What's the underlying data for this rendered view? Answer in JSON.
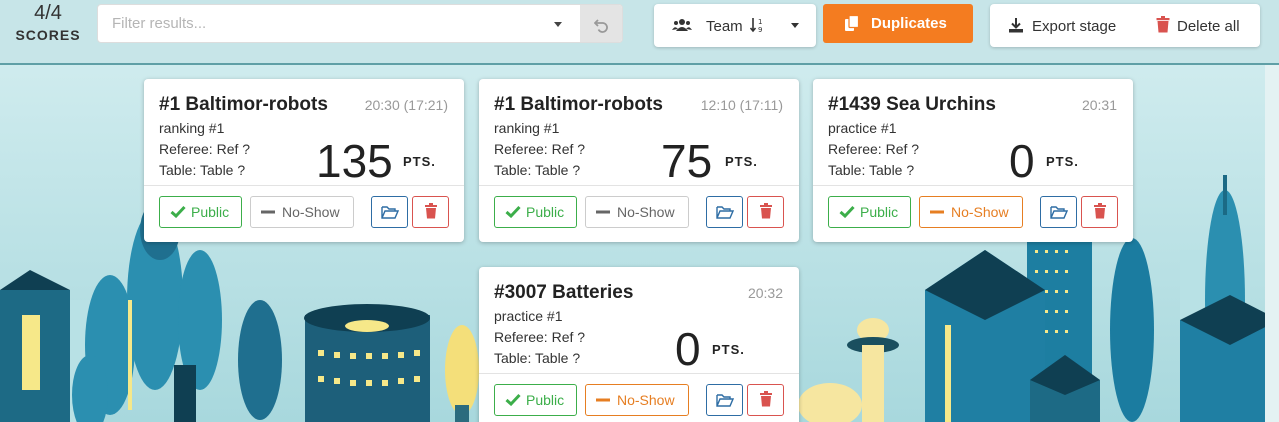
{
  "header": {
    "score_count": "4/4",
    "score_label": "SCORES",
    "filter_placeholder": "Filter results...",
    "sort_label": "Team",
    "duplicates_label": "Duplicates",
    "export_label": "Export stage",
    "delete_all_label": "Delete all"
  },
  "cards": [
    {
      "title": "#1 Baltimor-robots",
      "time": "20:30 (17:21)",
      "stage": "ranking #1",
      "referee": "Referee: Ref ?",
      "table": "Table: Table ?",
      "score": "135",
      "pts": "PTS.",
      "public_label": "Public",
      "noshow_label": "No-Show",
      "noshow_active": false
    },
    {
      "title": "#1 Baltimor-robots",
      "time": "12:10 (17:11)",
      "stage": "ranking #1",
      "referee": "Referee: Ref ?",
      "table": "Table: Table ?",
      "score": "75",
      "pts": "PTS.",
      "public_label": "Public",
      "noshow_label": "No-Show",
      "noshow_active": false
    },
    {
      "title": "#1439 Sea Urchins",
      "time": "20:31",
      "stage": "practice #1",
      "referee": "Referee: Ref ?",
      "table": "Table: Table ?",
      "score": "0",
      "pts": "PTS.",
      "public_label": "Public",
      "noshow_label": "No-Show",
      "noshow_active": true
    },
    {
      "title": "#3007 Batteries",
      "time": "20:32",
      "stage": "practice #1",
      "referee": "Referee: Ref ?",
      "table": "Table: Table ?",
      "score": "0",
      "pts": "PTS.",
      "public_label": "Public",
      "noshow_label": "No-Show",
      "noshow_active": true
    }
  ],
  "colors": {
    "accent_orange": "#f47c20",
    "public_green": "#3cae4a",
    "noshow_orange": "#e67e22",
    "open_blue": "#2e6da4",
    "delete_red": "#d9534f",
    "background": "#c9e9ec"
  },
  "icons": {
    "team": "users-icon",
    "sort": "sort-numeric-icon",
    "duplicates": "copy-icon",
    "export": "download-icon",
    "delete_all": "trash-icon",
    "reset": "undo-icon",
    "public": "check-icon",
    "noshow": "minus-icon",
    "open": "folder-open-icon",
    "delete": "trash-icon"
  }
}
